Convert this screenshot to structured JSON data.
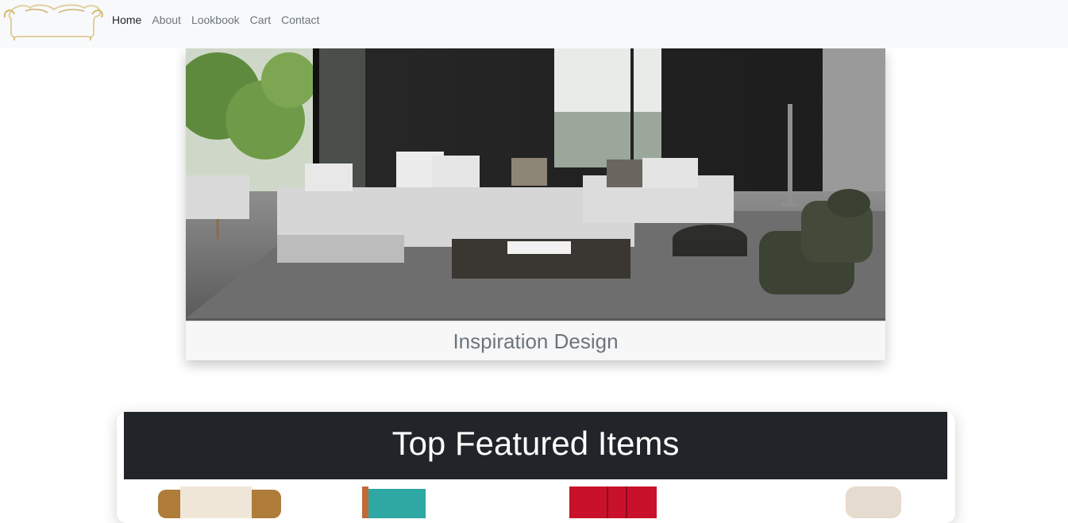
{
  "navbar": {
    "logo": "sofa-logo",
    "links": [
      "Home",
      "About",
      "Lookbook",
      "Cart",
      "Contact"
    ],
    "active": "Home"
  },
  "hero": {
    "image": "living-room-sectional-sofa",
    "caption": "Inspiration Design"
  },
  "featured": {
    "title": "Top Featured Items",
    "products": [
      {
        "image": "wicker-armchair"
      },
      {
        "image": "teal-chair"
      },
      {
        "image": "red-quilted-chair"
      },
      {
        "image": "beige-chair"
      }
    ]
  },
  "colors": {
    "navbar_bg": "#f8f9fa",
    "featured_header_bg": "#212529",
    "caption_text": "#6c757d"
  }
}
